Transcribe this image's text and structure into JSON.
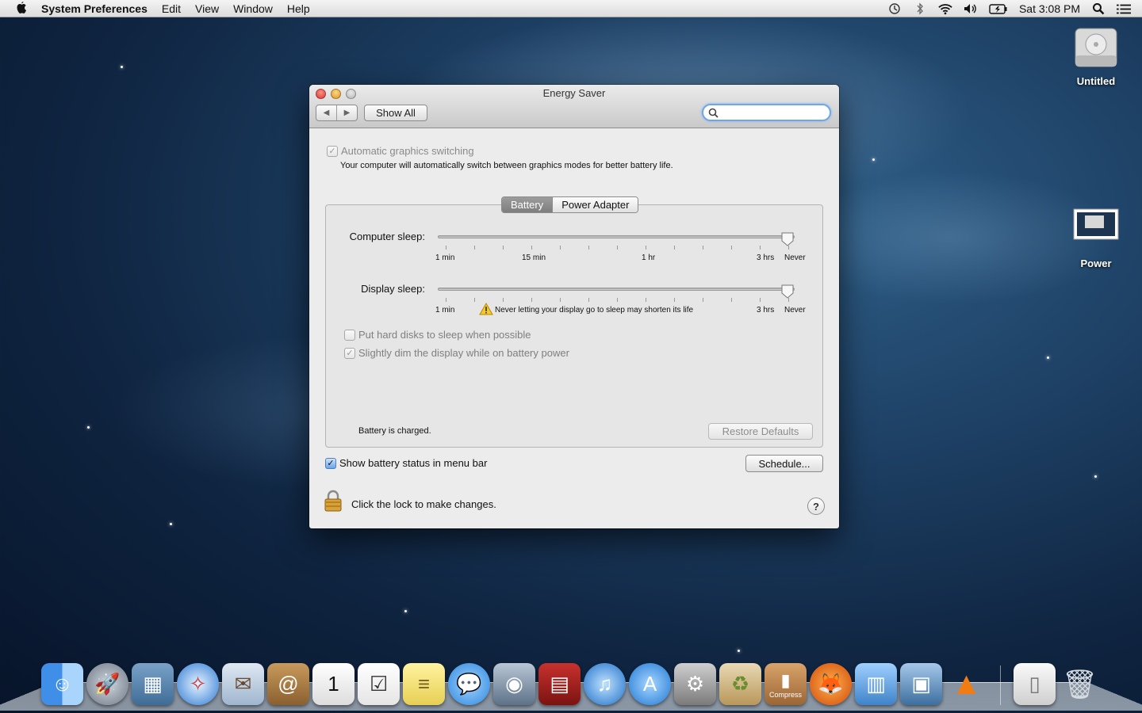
{
  "menubar": {
    "app_name": "System Preferences",
    "items": [
      "Edit",
      "View",
      "Window",
      "Help"
    ],
    "clock": "Sat 3:08 PM"
  },
  "desktop": {
    "icons": [
      {
        "label": "Untitled"
      },
      {
        "label": "Power"
      }
    ]
  },
  "window": {
    "title": "Energy Saver",
    "show_all_label": "Show All",
    "search_placeholder": "",
    "graphics": {
      "label": "Automatic graphics switching",
      "checked": true,
      "description": "Your computer will automatically switch between graphics modes for better battery life."
    },
    "tabs": [
      "Battery",
      "Power Adapter"
    ],
    "selected_tab": "Battery",
    "computer_sleep": {
      "label": "Computer sleep:",
      "tick_labels": [
        "1 min",
        "15 min",
        "1 hr",
        "3 hrs",
        "Never"
      ],
      "value": "Never"
    },
    "display_sleep": {
      "label": "Display sleep:",
      "tick_labels": [
        "1 min",
        "3 hrs",
        "Never"
      ],
      "warning": "Never letting your display go to sleep may shorten its life",
      "value": "Never"
    },
    "options": [
      {
        "label": "Put hard disks to sleep when possible",
        "checked": false
      },
      {
        "label": "Slightly dim the display while on battery power",
        "checked": true
      }
    ],
    "status_text": "Battery is charged.",
    "restore_defaults_label": "Restore Defaults",
    "show_battery_status": {
      "label": "Show battery status in menu bar",
      "checked": true
    },
    "schedule_label": "Schedule...",
    "lock_text": "Click the lock to make changes.",
    "help_label": "?"
  },
  "dock": {
    "items": [
      "finder-icon",
      "launchpad-icon",
      "photo-browser-icon",
      "safari-icon",
      "mail-icon",
      "contacts-icon",
      "calendar-icon",
      "reminders-icon",
      "notes-icon",
      "messages-icon",
      "facetime-icon",
      "photo-booth-icon",
      "itunes-icon",
      "app-store-icon",
      "system-preferences-icon",
      "recycle-app-icon",
      "compress-icon",
      "firefox-icon",
      "remote-desktop-icon",
      "preview-utility-icon",
      "vlc-icon",
      "documents-stack-icon",
      "trash-icon"
    ],
    "compress_label": "Compress"
  }
}
